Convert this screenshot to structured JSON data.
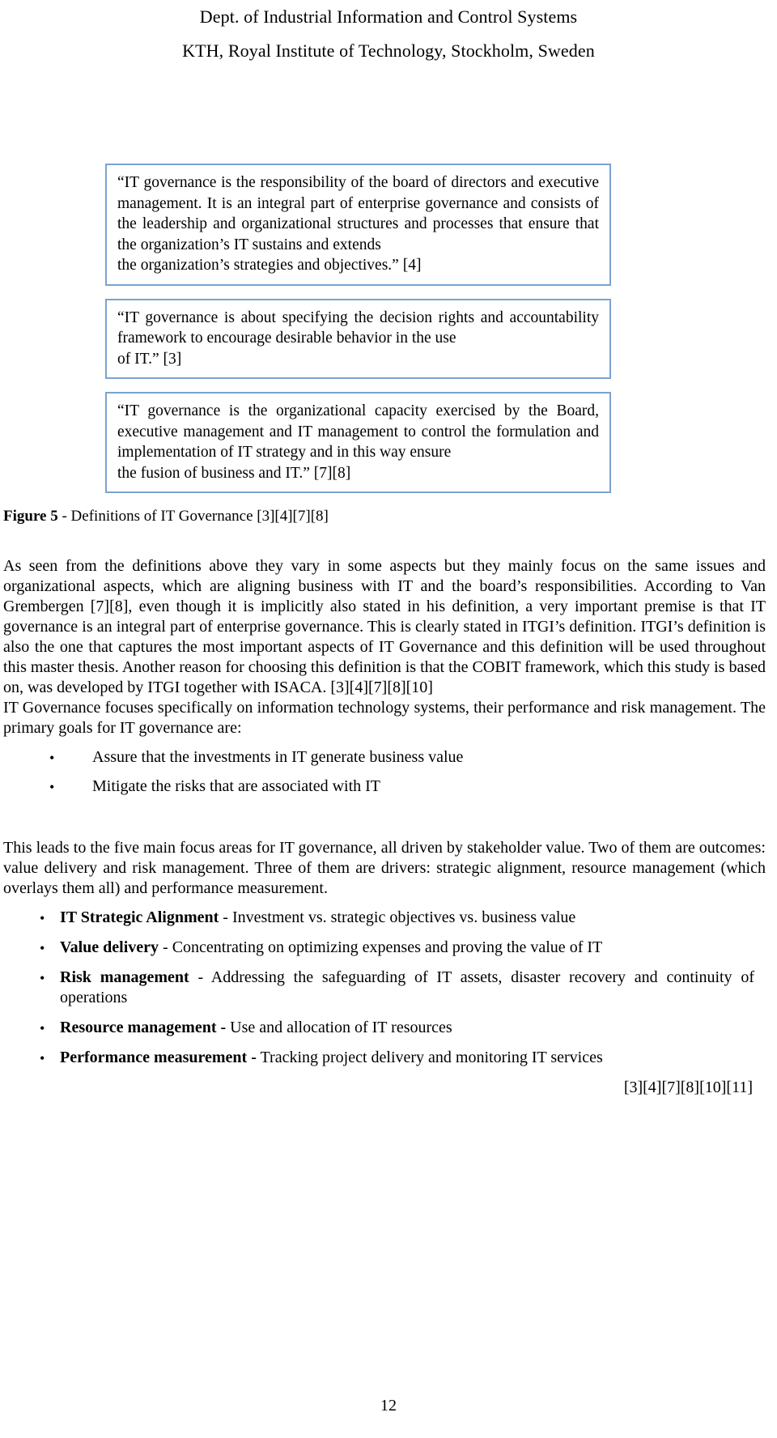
{
  "header": {
    "line1": "Dept. of Industrial Information and Control Systems",
    "line2": "KTH, Royal Institute of Technology, Stockholm, Sweden"
  },
  "quotes": [
    {
      "text": "“IT governance is the responsibility of the board of directors and executive management. It is an integral part of enterprise governance and consists of the leadership and organizational structures and processes that ensure that the organization’s IT sustains and extends",
      "tail": "the organization’s strategies and objectives.” [4]"
    },
    {
      "text": "“IT governance is about specifying the decision rights and accountability framework to encourage desirable behavior in the use",
      "tail": "of IT.” [3]"
    },
    {
      "text": "“IT governance is the organizational capacity exercised by the Board, executive management and IT management to control the formulation and implementation of IT strategy and in this way ensure",
      "tail": "the fusion of business and IT.” [7][8]"
    }
  ],
  "figure": {
    "label": "Figure 5",
    "caption": " - Definitions of IT Governance [3][4][7][8]"
  },
  "body": {
    "para1": "As seen from the definitions above they vary in some aspects but they mainly focus on the same issues and organizational aspects, which are aligning business with IT and the board’s responsibilities. According to Van Grembergen [7][8], even though it is implicitly also stated in his definition, a very important premise is that IT governance is an integral part of enterprise governance. This is clearly stated in ITGI’s definition. ITGI’s definition is also the one that captures the most important aspects of IT Governance and this definition will be used throughout this master thesis. Another reason for choosing this definition is that the COBIT framework, which this study is based on, was developed by ITGI together with ISACA. [3][4][7][8][10]",
    "para2": "IT Governance focuses specifically on information technology systems, their performance and risk management. The primary goals for IT governance are:",
    "para3": "This leads to the five main focus areas for IT governance, all driven by stakeholder value. Two of them are outcomes: value delivery and risk management. Three of them are drivers: strategic alignment, resource management (which overlays them all) and performance measurement."
  },
  "goals_list": {
    "bullet_glyph": "•",
    "items": [
      "Assure that the investments in IT generate business value",
      "Mitigate the risks that are associated with IT"
    ]
  },
  "focus_list": {
    "bullet_glyph": "•",
    "items": [
      {
        "term": "IT Strategic Alignment",
        "desc": " - Investment vs. strategic objectives vs. business value"
      },
      {
        "term": "Value delivery",
        "desc": " - Concentrating on optimizing expenses and proving the value of IT"
      },
      {
        "term": "Risk management",
        "desc": " - Addressing the safeguarding of IT assets, disaster recovery and continuity of operations"
      },
      {
        "term": "Resource management -",
        "desc": " Use and allocation of IT resources"
      },
      {
        "term": "Performance measurement -",
        "desc": " Tracking project delivery and monitoring IT services"
      }
    ]
  },
  "references_line": "[3][4][7][8][10][11]",
  "page_number": "12",
  "colors": {
    "box_border": "#7ba2d0",
    "text": "#000000",
    "background": "#ffffff"
  }
}
